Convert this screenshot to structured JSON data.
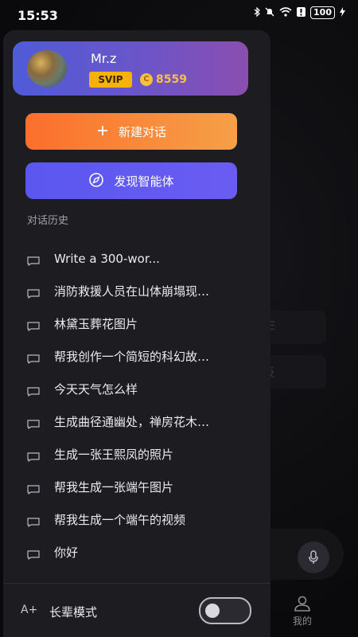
{
  "status_bar": {
    "time": "15:53",
    "battery": "100"
  },
  "profile": {
    "username": "Mr.z",
    "badge": "SVIP",
    "coin_symbol": "C",
    "coins": "8559"
  },
  "actions": {
    "new_chat": {
      "icon": "plus-icon",
      "label": "新建对话"
    },
    "discover_agents": {
      "icon": "compass-icon",
      "label": "发现智能体"
    }
  },
  "history": {
    "label": "对话历史",
    "items": [
      {
        "title": "Write a 300-wor..."
      },
      {
        "title": "消防救援人员在山体崩塌现…"
      },
      {
        "title": "林黛玉葬花图片"
      },
      {
        "title": "帮我创作一个简短的科幻故…"
      },
      {
        "title": "今天天气怎么样"
      },
      {
        "title": "生成曲径通幽处，禅房花木…"
      },
      {
        "title": "生成一张王熙凤的照片"
      },
      {
        "title": "帮我生成一张端午图片"
      },
      {
        "title": "帮我生成一个端午的视频"
      },
      {
        "title": "你好"
      }
    ]
  },
  "elder_mode": {
    "icon_text": "A+",
    "label": "长辈模式",
    "enabled": false
  },
  "background": {
    "tab_label": "我的",
    "card_texts": [
      "E",
      "反"
    ]
  },
  "colors": {
    "new_chat": "#fb6f2c",
    "discover": "#5a57f0",
    "svip": "#f6b10a",
    "coins": "#f6c243"
  }
}
